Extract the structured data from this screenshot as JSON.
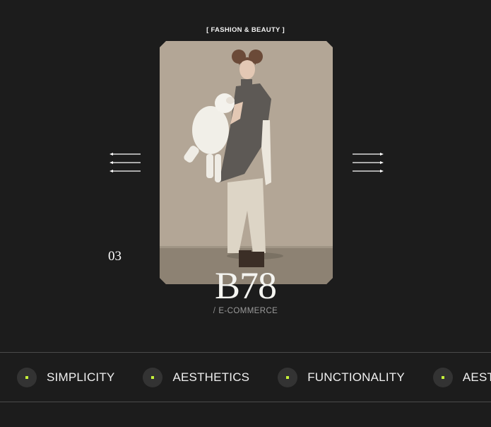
{
  "category": "[ FASHION & BEAUTY ]",
  "project": {
    "counter": "03",
    "title": "B78",
    "subtitle_separator": "/",
    "subtitle": "E-COMMERCE",
    "image_alt": "Model in grey sleeveless top holding a white lamb toy"
  },
  "nav": {
    "prev_icon": "arrow-left-lines-icon",
    "next_icon": "arrow-right-lines-icon"
  },
  "ticker": {
    "items": [
      "SIMPLICITY",
      "AESTHETICS",
      "FUNCTIONALITY",
      "AESTHETICS"
    ],
    "bullet_color": "#c6f23a"
  },
  "colors": {
    "background": "#1c1c1c",
    "accent": "#c6f23a",
    "divider": "#4a4a4a"
  }
}
